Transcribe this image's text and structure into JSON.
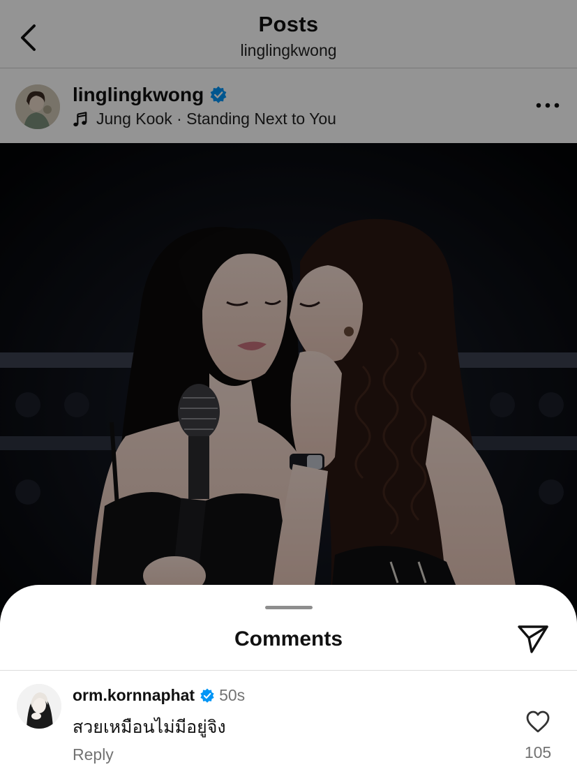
{
  "topbar": {
    "title": "Posts",
    "subtitle": "linglingkwong",
    "back_icon": "chevron-left-icon"
  },
  "post": {
    "username": "linglingkwong",
    "verified": true,
    "music": "Jung Kook · Standing Next to You",
    "music_icon": "music-note-icon",
    "more_icon": "more-horizontal-icon",
    "image_description_icon": "photo"
  },
  "comments_sheet": {
    "title": "Comments",
    "share_icon": "send-icon",
    "items": [
      {
        "username": "orm.kornnaphat",
        "verified": true,
        "time": "50s",
        "text": "สวยเหมือนไม่มีอยู่จิง",
        "reply_label": "Reply",
        "like_count": "105",
        "like_icon": "heart-outline-icon"
      }
    ]
  },
  "colors": {
    "verified_blue": "#0095f6",
    "secondary_text": "#737373",
    "primary_text": "#111111",
    "dim_overlay": "rgba(0,0,0,0.42)"
  }
}
